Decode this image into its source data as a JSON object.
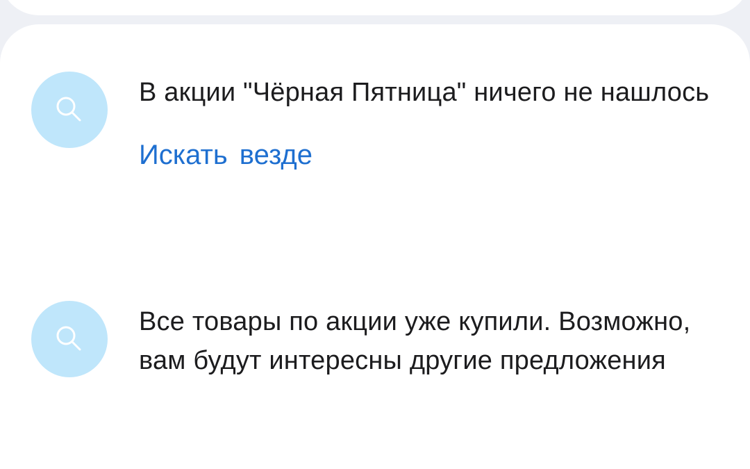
{
  "empty_promo": {
    "message": "В акции \"Чёрная Пятница\" ничего не нашлось",
    "search_everywhere_label": "Искать  везде",
    "icon": "search-icon"
  },
  "sold_out": {
    "message": "Все товары по акции уже купили. Возможно, вам будут интересны другие предложения",
    "icon": "search-icon"
  },
  "colors": {
    "link": "#1e6fd0",
    "icon_circle": "#bfe6fb",
    "icon_glyph": "#ffffff",
    "text": "#1c1c1e",
    "background": "#eef0f5",
    "card": "#ffffff"
  }
}
